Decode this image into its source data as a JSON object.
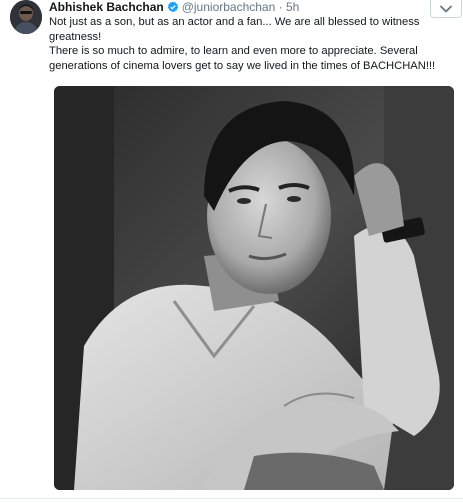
{
  "tweet": {
    "author_name": "Abhishek Bachchan",
    "handle": "@juniorbachchan",
    "separator": "·",
    "time": "5h",
    "text_lines": [
      "Not just as a son, but as an actor and a fan... We are all blessed to witness greatness!",
      "There is so much to admire, to learn and even more to appreciate. Several generations of cinema lovers get to say we lived in the times of BACHCHAN!!!"
    ]
  },
  "icons": {
    "verified": "verified-badge-icon",
    "caret": "chevron-down-icon"
  },
  "colors": {
    "accent": "#1da1f2",
    "muted": "#657786",
    "text": "#14171a"
  }
}
